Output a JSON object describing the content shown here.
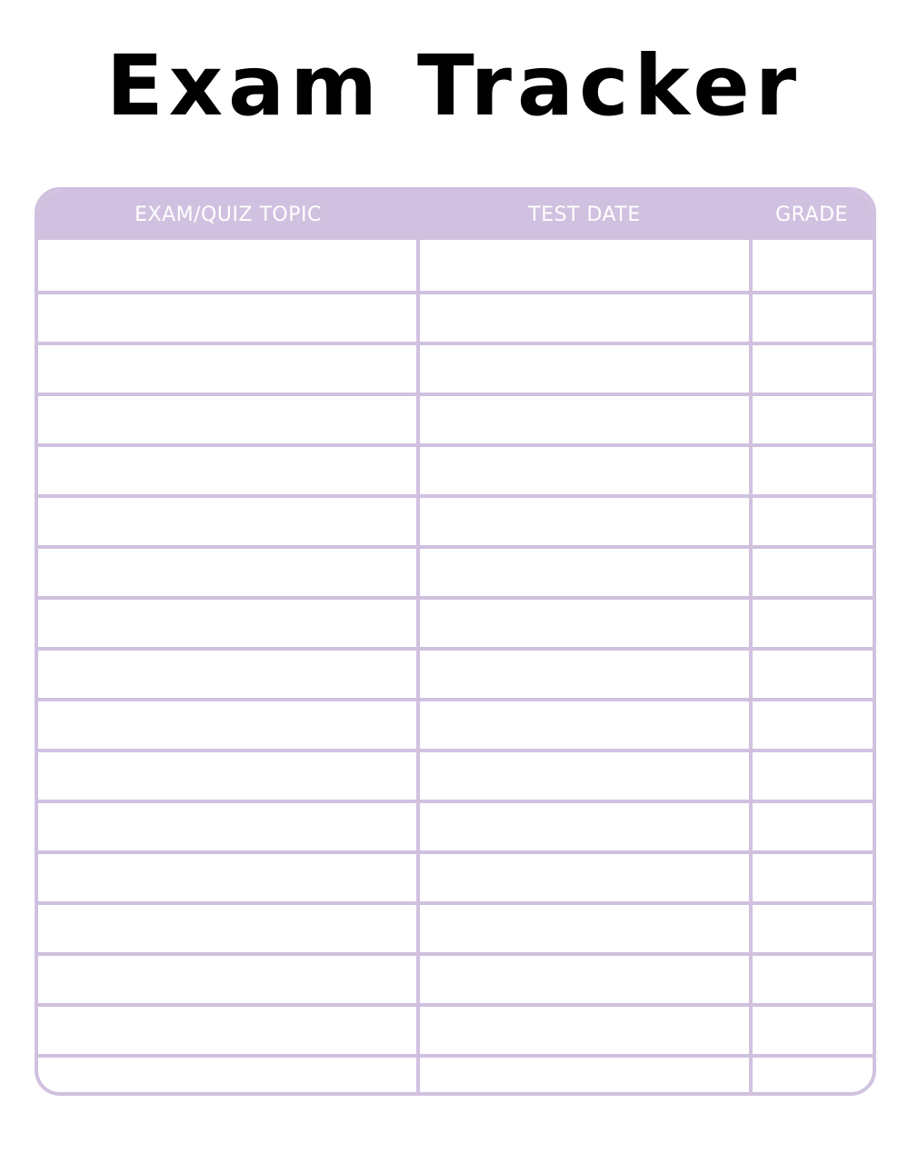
{
  "title": "Exam Tracker",
  "colors": {
    "accent": "#d1c1e0",
    "header_text": "#ffffff",
    "title_text": "#000000"
  },
  "table": {
    "columns": [
      "EXAM/QUIZ TOPIC",
      "TEST DATE",
      "GRADE"
    ],
    "rows": [
      [
        "",
        "",
        ""
      ],
      [
        "",
        "",
        ""
      ],
      [
        "",
        "",
        ""
      ],
      [
        "",
        "",
        ""
      ],
      [
        "",
        "",
        ""
      ],
      [
        "",
        "",
        ""
      ],
      [
        "",
        "",
        ""
      ],
      [
        "",
        "",
        ""
      ],
      [
        "",
        "",
        ""
      ],
      [
        "",
        "",
        ""
      ],
      [
        "",
        "",
        ""
      ],
      [
        "",
        "",
        ""
      ],
      [
        "",
        "",
        ""
      ],
      [
        "",
        "",
        ""
      ],
      [
        "",
        "",
        ""
      ],
      [
        "",
        "",
        ""
      ],
      [
        "",
        "",
        ""
      ]
    ]
  }
}
